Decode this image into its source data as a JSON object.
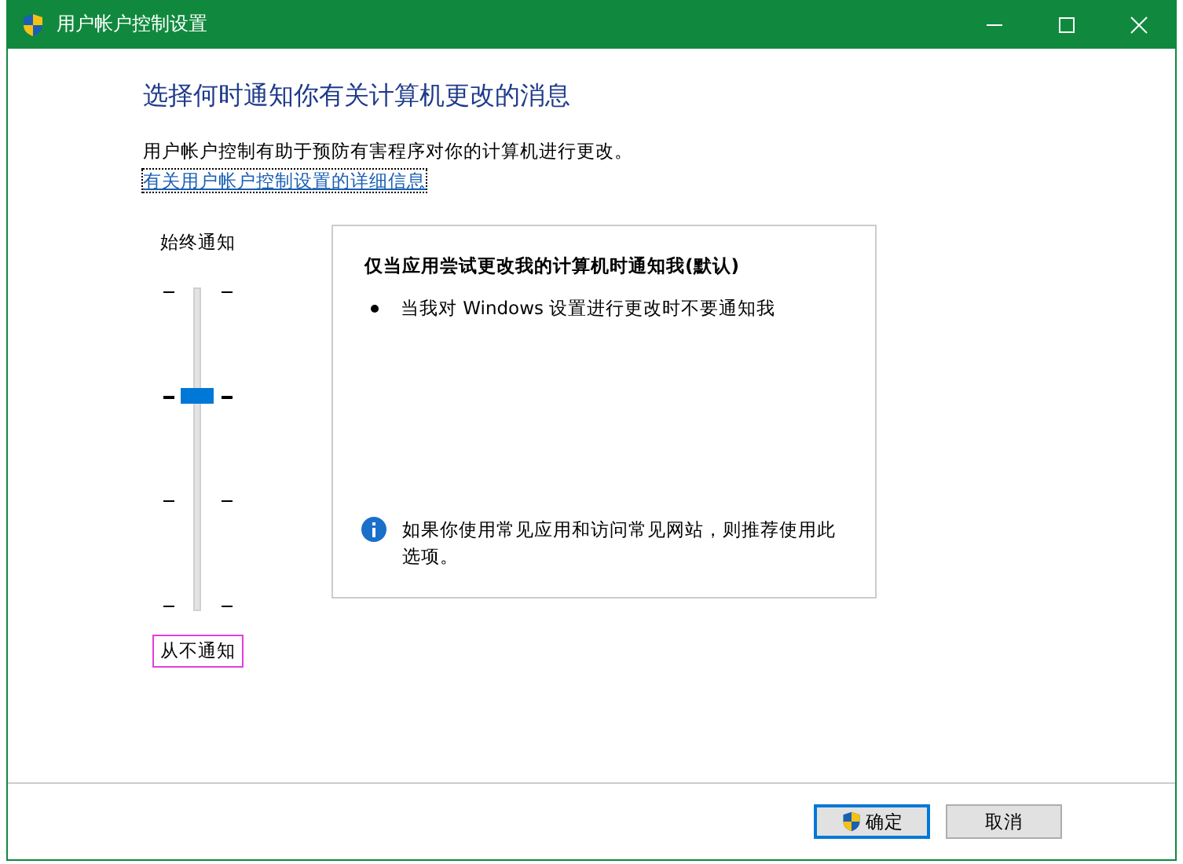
{
  "window": {
    "title": "用户帐户控制设置"
  },
  "heading": "选择何时通知你有关计算机更改的消息",
  "description": "用户帐户控制有助于预防有害程序对你的计算机进行更改。",
  "link": "有关用户帐户控制设置的详细信息",
  "slider": {
    "top_label": "始终通知",
    "bottom_label": "从不通知",
    "level": 0.67
  },
  "info_panel": {
    "title": "仅当应用尝试更改我的计算机时通知我(默认)",
    "bullets": [
      "当我对 Windows 设置进行更改时不要通知我"
    ],
    "note": "如果你使用常见应用和访问常见网站，则推荐使用此选项。"
  },
  "buttons": [
    {
      "label": "确定",
      "shield": true
    },
    {
      "label": "取消",
      "shield": false
    }
  ]
}
